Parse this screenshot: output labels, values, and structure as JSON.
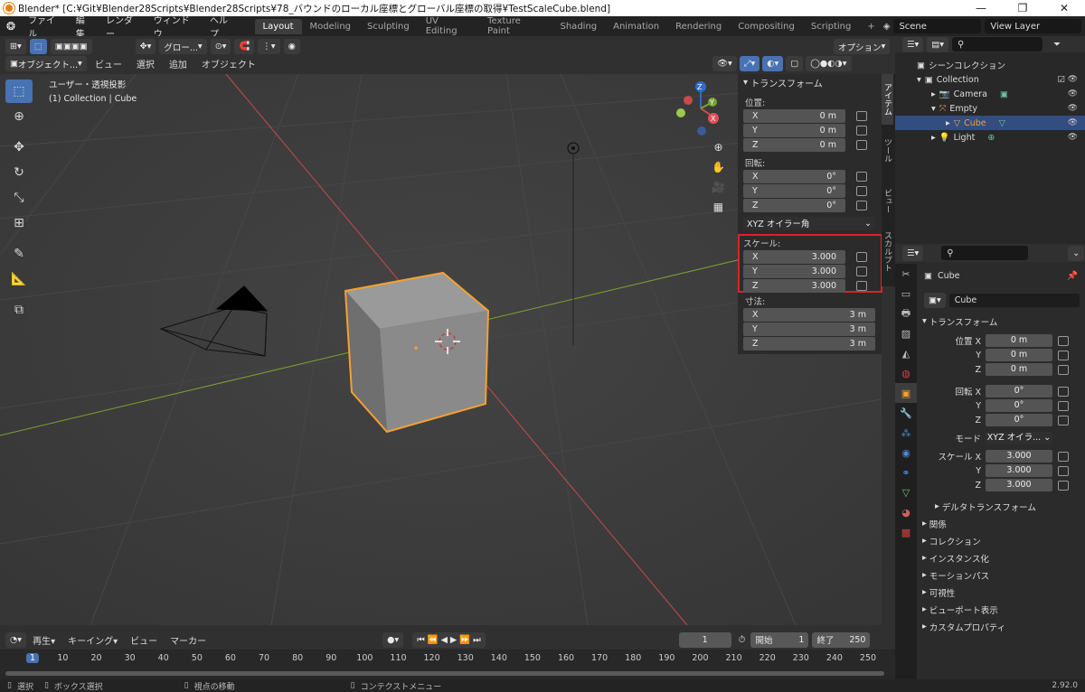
{
  "titlebar": {
    "title": "Blender* [C:¥Git¥Blender28Scripts¥Blender28Scripts¥78_バウンドのローカル座標とグローバル座標の取得¥TestScaleCube.blend]"
  },
  "menu": {
    "items": [
      "ファイル",
      "編集",
      "レンダー",
      "ウィンドウ",
      "ヘルプ"
    ],
    "workspaces": [
      "Layout",
      "Modeling",
      "Sculpting",
      "UV Editing",
      "Texture Paint",
      "Shading",
      "Animation",
      "Rendering",
      "Compositing",
      "Scripting"
    ],
    "add_workspace": "+",
    "scene": "Scene",
    "view_layer": "View Layer"
  },
  "viewport_header": {
    "transform_orientation": "グロー...",
    "options": "オプション",
    "mode": "オブジェクト...",
    "menus": [
      "ビュー",
      "選択",
      "追加",
      "オブジェクト"
    ]
  },
  "viewport": {
    "view_name": "ユーザー・透視投影",
    "collection_info": "(1) Collection | Cube",
    "gizmo": {
      "x": "X",
      "y": "Y",
      "z": "Z"
    }
  },
  "npanel": {
    "header": "トランスフォーム",
    "location_label": "位置:",
    "location": [
      {
        "axis": "X",
        "value": "0 m"
      },
      {
        "axis": "Y",
        "value": "0 m"
      },
      {
        "axis": "Z",
        "value": "0 m"
      }
    ],
    "rotation_label": "回転:",
    "rotation": [
      {
        "axis": "X",
        "value": "0°"
      },
      {
        "axis": "Y",
        "value": "0°"
      },
      {
        "axis": "Z",
        "value": "0°"
      }
    ],
    "rotation_mode": "XYZ オイラー角",
    "scale_label": "スケール:",
    "scale": [
      {
        "axis": "X",
        "value": "3.000"
      },
      {
        "axis": "Y",
        "value": "3.000"
      },
      {
        "axis": "Z",
        "value": "3.000"
      }
    ],
    "dimensions_label": "寸法:",
    "dimensions": [
      {
        "axis": "X",
        "value": "3 m"
      },
      {
        "axis": "Y",
        "value": "3 m"
      },
      {
        "axis": "Z",
        "value": "3 m"
      }
    ],
    "highlight_color": "#e0202a",
    "tabs": [
      "アイテム",
      "ツール",
      "ビュー",
      "スカルプト"
    ]
  },
  "outliner": {
    "items": [
      {
        "name": "シーンコレクション"
      },
      {
        "name": "Collection"
      },
      {
        "name": "Camera"
      },
      {
        "name": "Empty"
      },
      {
        "name": "Cube"
      },
      {
        "name": "Light"
      }
    ]
  },
  "properties": {
    "object_name": "Cube",
    "datablock_name": "Cube",
    "transform_header": "トランスフォーム",
    "location": {
      "label_x": "位置 X",
      "x": "0 m",
      "y": "0 m",
      "z": "0 m"
    },
    "rotation": {
      "label_x": "回転 X",
      "x": "0°",
      "y": "0°",
      "z": "0°"
    },
    "mode_label": "モード",
    "mode_value": "XYZ オイラ...",
    "scale": {
      "label_x": "スケール X",
      "x": "3.000",
      "y": "3.000",
      "z": "3.000"
    },
    "axis_y": "Y",
    "axis_z": "Z",
    "delta": "デルタトランスフォーム",
    "sections": [
      "関係",
      "コレクション",
      "インスタンス化",
      "モーションパス",
      "可視性",
      "ビューポート表示",
      "カスタムプロパティ"
    ]
  },
  "timeline": {
    "menus": [
      "再生",
      "キーイング",
      "ビュー",
      "マーカー"
    ],
    "current_frame": "1",
    "start_label": "開始",
    "start": "1",
    "end_label": "終了",
    "end": "250",
    "ticks": [
      "1",
      "10",
      "20",
      "30",
      "40",
      "50",
      "60",
      "70",
      "80",
      "90",
      "100",
      "110",
      "120",
      "130",
      "140",
      "150",
      "160",
      "170",
      "180",
      "190",
      "200",
      "210",
      "220",
      "230",
      "240",
      "250"
    ]
  },
  "statusbar": {
    "select": "選択",
    "box_select": "ボックス選択",
    "rotate_view": "視点の移動",
    "context_menu": "コンテクストメニュー",
    "version": "2.92.0"
  },
  "colors": {
    "accent": "#4772b3",
    "selection_orange": "#f5a033",
    "x_axis": "#c94a4a",
    "y_axis": "#7aa332"
  }
}
